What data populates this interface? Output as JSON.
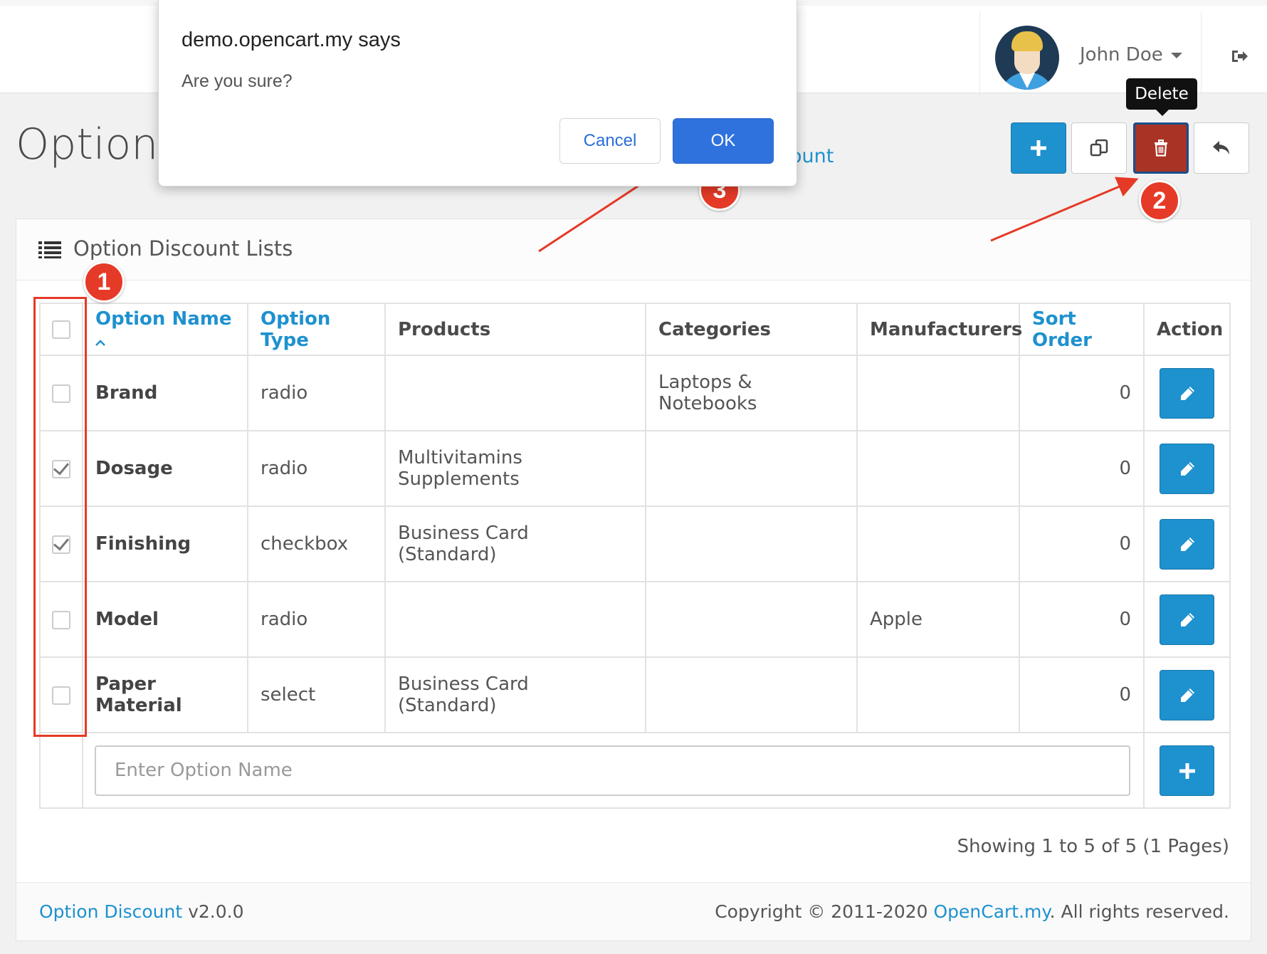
{
  "header": {
    "user_name": "John Doe"
  },
  "page": {
    "title": "Option",
    "breadcrumb_fragment": "ount",
    "tooltip": "Delete"
  },
  "panel": {
    "title": "Option Discount Lists",
    "columns": [
      "Option Name",
      "Option Type",
      "Products",
      "Categories",
      "Manufacturers",
      "Sort Order",
      "Action"
    ],
    "sort_indicator": "^",
    "rows": [
      {
        "name": "Brand",
        "type": "radio",
        "products": "",
        "categories": "Laptops & Notebooks",
        "manufacturers": "",
        "sort_order": "0",
        "checked": false
      },
      {
        "name": "Dosage",
        "type": "radio",
        "products": "Multivitamins Supplements",
        "categories": "",
        "manufacturers": "",
        "sort_order": "0",
        "checked": true
      },
      {
        "name": "Finishing",
        "type": "checkbox",
        "products": "Business Card (Standard)",
        "categories": "",
        "manufacturers": "",
        "sort_order": "0",
        "checked": true
      },
      {
        "name": "Model",
        "type": "radio",
        "products": "",
        "categories": "",
        "manufacturers": "Apple",
        "sort_order": "0",
        "checked": false
      },
      {
        "name": "Paper Material",
        "type": "select",
        "products": "Business Card (Standard)",
        "categories": "",
        "manufacturers": "",
        "sort_order": "0",
        "checked": false
      }
    ],
    "new_option_placeholder": "Enter Option Name",
    "pagination": "Showing 1 to 5 of 5 (1 Pages)"
  },
  "footer": {
    "product_link": "Option Discount",
    "version": " v2.0.0",
    "copyright_prefix": "Copyright © 2011-2020 ",
    "company_link": "OpenCart.my",
    "copyright_suffix": ". All rights reserved."
  },
  "dialog": {
    "title": "demo.opencart.my says",
    "message": "Are you sure?",
    "cancel_label": "Cancel",
    "ok_label": "OK"
  },
  "annotations": {
    "step1": "1",
    "step2": "2",
    "step3": "3",
    "color": "#e53a27"
  },
  "colors": {
    "primary": "#1e91cf",
    "danger": "#a93426",
    "dialog_ok": "#2f72dd"
  }
}
